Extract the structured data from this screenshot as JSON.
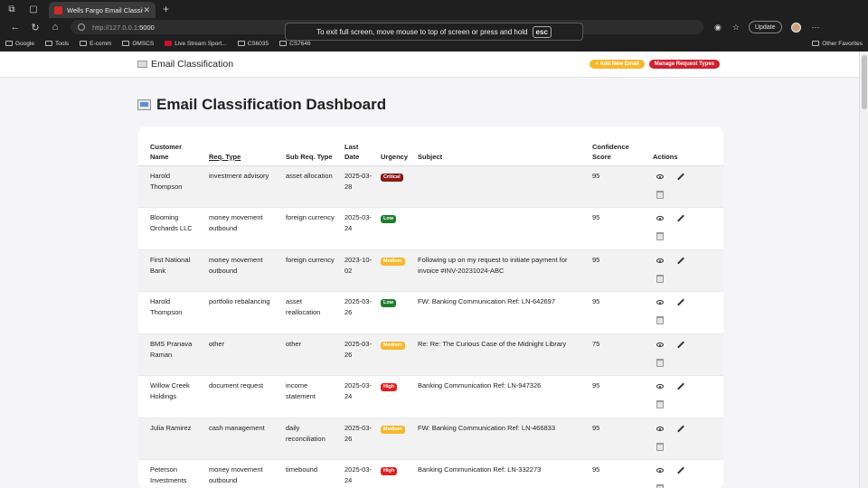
{
  "browser": {
    "tab_title": "Wells Fargo Email Classification",
    "url_host": "http://127.0.0.1",
    "url_port": ":5000",
    "update_label": "Update",
    "fullscreen_msg": "To exit full screen, move mouse to top of screen or press and hold",
    "fullscreen_key": "esc",
    "bookmarks": [
      "Google",
      "Tools",
      "E-comm",
      "OMSCS",
      "Live Stream Sport...",
      "CS6035",
      "CS7646"
    ],
    "other_favorites": "Other Favorites"
  },
  "nav": {
    "brand": "Email Classification",
    "add_email": "+ Add New Email",
    "manage_types": "Manage Request Types"
  },
  "page_title": "Email Classification Dashboard",
  "table": {
    "headers": {
      "customer": "Customer Name",
      "req_type": "Req. Type",
      "sub_req": "Sub Req. Type",
      "last_date": "Last Date",
      "urgency": "Urgency",
      "subject": "Subject",
      "confidence": "Confidence Score",
      "actions": "Actions"
    },
    "rows": [
      {
        "customer": "Harold Thompson",
        "req_type": "investment advisory",
        "sub_req": "asset allocation",
        "date": "2025-03-28",
        "urgency": "Critical",
        "subject": "",
        "score": "95"
      },
      {
        "customer": "Blooming Orchards LLC",
        "req_type": "money movement outbound",
        "sub_req": "foreign currency",
        "date": "2025-03-24",
        "urgency": "Low",
        "subject": "",
        "score": "95"
      },
      {
        "customer": "First National Bank",
        "req_type": "money movement outbound",
        "sub_req": "foreign currency",
        "date": "2023-10-02",
        "urgency": "Medium",
        "subject": "Following up on my request to initiate payment for invoice #INV-20231024-ABC",
        "score": "95"
      },
      {
        "customer": "Harold Thompson",
        "req_type": "portfolio rebalancing",
        "sub_req": "asset reallocation",
        "date": "2025-03-26",
        "urgency": "Low",
        "subject": "FW: Banking Communication Ref: LN-642697",
        "score": "95"
      },
      {
        "customer": "BMS Pranava Raman",
        "req_type": "other",
        "sub_req": "other",
        "date": "2025-03-26",
        "urgency": "Medium",
        "subject": "Re: Re: The Curious Case of the Midnight Library",
        "score": "75"
      },
      {
        "customer": "Willow Creek Holdings",
        "req_type": "document request",
        "sub_req": "income statement",
        "date": "2025-03-24",
        "urgency": "High",
        "subject": "Banking Communication Ref: LN-947326",
        "score": "95"
      },
      {
        "customer": "Julia Ramirez",
        "req_type": "cash management",
        "sub_req": "daily reconciliation",
        "date": "2025-03-26",
        "urgency": "Medium",
        "subject": "FW: Banking Communication Ref: LN-466833",
        "score": "95"
      },
      {
        "customer": "Peterson Investments",
        "req_type": "money movement outbound",
        "sub_req": "timebound",
        "date": "2025-03-24",
        "urgency": "High",
        "subject": "Banking Communication Ref: LN-332273",
        "score": "95"
      }
    ]
  },
  "colors": {
    "Critical": "#8b1a1a",
    "Low": "#1e7d2c",
    "Medium": "#f5b82e",
    "High": "#e02020"
  }
}
